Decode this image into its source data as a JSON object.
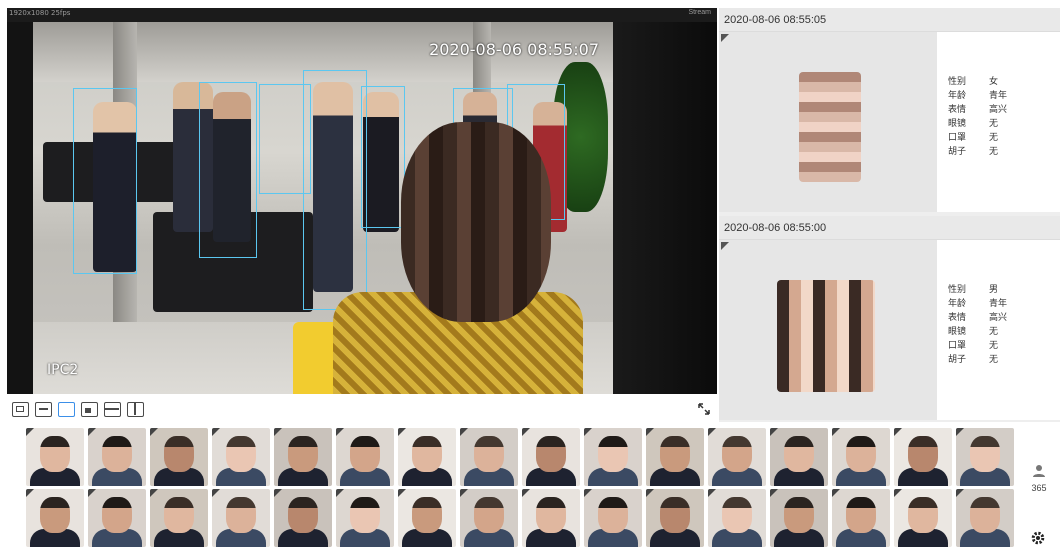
{
  "video": {
    "resolution_text": "1920x1080 25fps",
    "status_text": "Stream",
    "timestamp": "2020-08-06 08:55:07",
    "camera_label": "IPC2"
  },
  "toolbar": {
    "buttons": [
      "layout-1",
      "layout-2",
      "layout-3",
      "layout-4",
      "layout-5",
      "layout-6"
    ],
    "active_index": 2,
    "accent_color": "#3b8fe8"
  },
  "face_cards": [
    {
      "time": "2020-08-06 08:55:05",
      "attributes": [
        {
          "key": "性别",
          "value": "女"
        },
        {
          "key": "年龄",
          "value": "青年"
        },
        {
          "key": "表情",
          "value": "高兴"
        },
        {
          "key": "眼镜",
          "value": "无"
        },
        {
          "key": "口罩",
          "value": "无"
        },
        {
          "key": "胡子",
          "value": "无"
        }
      ]
    },
    {
      "time": "2020-08-06 08:55:00",
      "attributes": [
        {
          "key": "性别",
          "value": "男"
        },
        {
          "key": "年龄",
          "value": "青年"
        },
        {
          "key": "表情",
          "value": "高兴"
        },
        {
          "key": "眼镜",
          "value": "无"
        },
        {
          "key": "口罩",
          "value": "无"
        },
        {
          "key": "胡子",
          "value": "无"
        }
      ]
    }
  ],
  "capture_count": "365",
  "box_color": "#5bc7f0"
}
